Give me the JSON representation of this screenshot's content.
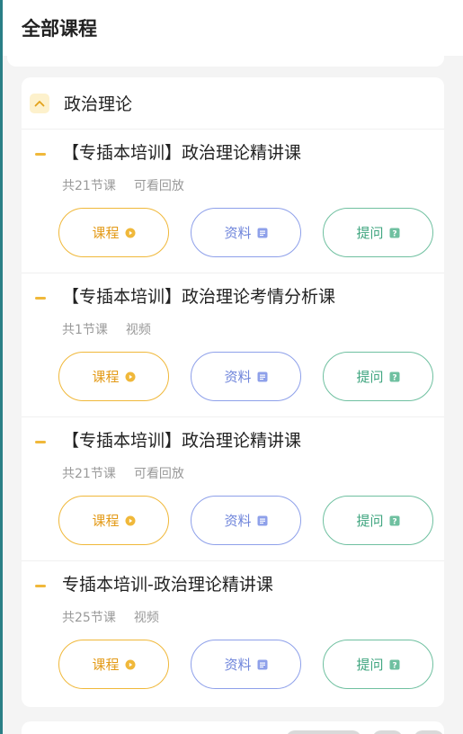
{
  "header": {
    "title": "全部课程"
  },
  "section": {
    "title": "政治理论",
    "collapse_icon": "chevron-up-icon",
    "courses": [
      {
        "title": "【专插本培训】政治理论精讲课",
        "lessons": "共21节课",
        "type": "可看回放"
      },
      {
        "title": "【专插本培训】政治理论考情分析课",
        "lessons": "共1节课",
        "type": "视频"
      },
      {
        "title": "【专插本培训】政治理论精讲课",
        "lessons": "共21节课",
        "type": "可看回放"
      },
      {
        "title": "专插本培训-政治理论精讲课",
        "lessons": "共25节课",
        "type": "视频"
      }
    ]
  },
  "buttons": {
    "course_label": "课程",
    "material_label": "资料",
    "ask_label": "提问"
  },
  "colors": {
    "course_accent": "#f0b83a",
    "material_accent": "#8ea0ea",
    "ask_accent": "#6fc0a0"
  }
}
